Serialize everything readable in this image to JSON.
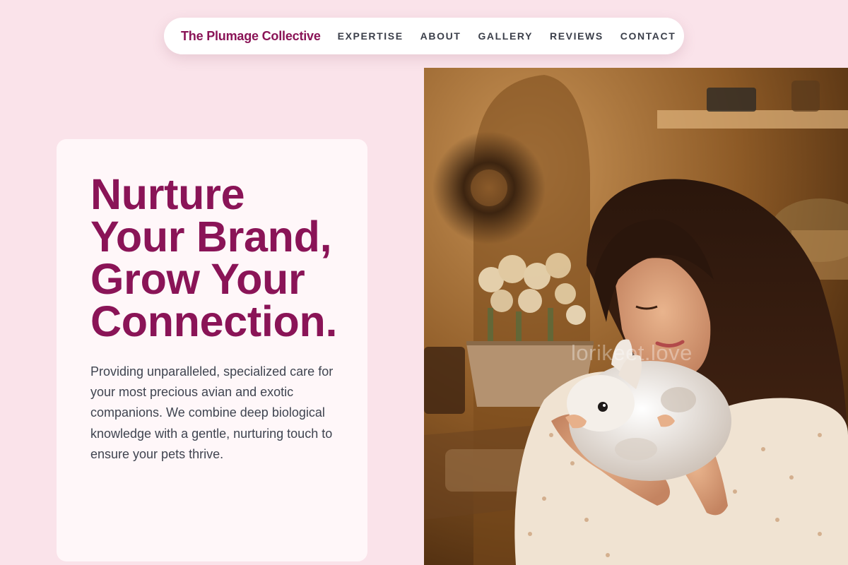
{
  "nav": {
    "brand": "The Plumage Collective",
    "links": [
      {
        "label": "EXPERTISE"
      },
      {
        "label": "ABOUT"
      },
      {
        "label": "GALLERY"
      },
      {
        "label": "REVIEWS"
      },
      {
        "label": "CONTACT"
      }
    ]
  },
  "hero": {
    "headline": [
      "Nurture",
      "Your Brand,",
      "Grow Your",
      "Connection."
    ],
    "description": "Providing unparalleled, specialized care for your most precious avian and exotic companions. We combine deep biological knowledge with a gentle, nurturing touch to ensure your pets thrive.",
    "image": {
      "watermark": "lorikeet.love",
      "icon": "woman-holding-rabbit-photo"
    }
  },
  "colors": {
    "page_background": "#fae3ea",
    "brand": "#8a1457",
    "nav_text": "#3b3f4a",
    "body_text": "#3f4450",
    "card_background": "#fff7f9"
  }
}
